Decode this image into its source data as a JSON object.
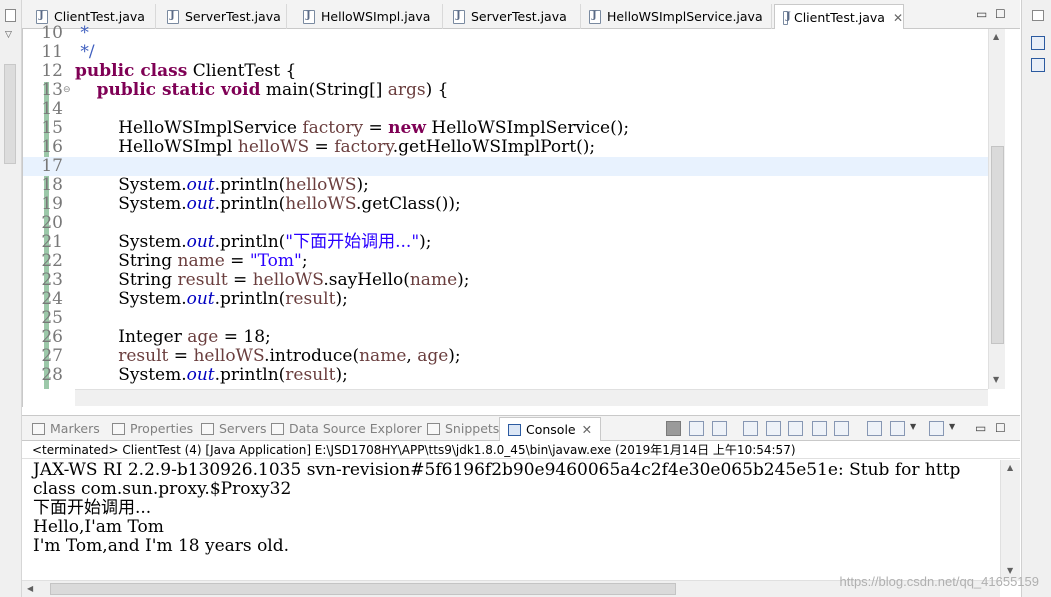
{
  "editor_tabs": [
    {
      "label": "ClientTest.java",
      "active": false
    },
    {
      "label": "ServerTest.java",
      "active": false
    },
    {
      "label": "HelloWSImpl.java",
      "active": false
    },
    {
      "label": "ServerTest.java",
      "active": false
    },
    {
      "label": "HelloWSImplService.java",
      "active": false
    },
    {
      "label": "ClientTest.java",
      "active": true
    }
  ],
  "code_lines": [
    {
      "num": "10",
      "html": " <span class=\"cmt\">*</span>"
    },
    {
      "num": "11",
      "html": " <span class=\"cmt\">*/</span>"
    },
    {
      "num": "12",
      "html": "<span class=\"kw\">public class</span> ClientTest {"
    },
    {
      "num": "13",
      "html": "    <span class=\"kw\">public static void</span> main(String[] <span class=\"var\">args</span>) {"
    },
    {
      "num": "14",
      "html": ""
    },
    {
      "num": "15",
      "html": "        HelloWSImplService <span class=\"var\">factory</span> = <span class=\"kw\">new</span> HelloWSImplService();"
    },
    {
      "num": "16",
      "html": "        HelloWSImpl <span class=\"var\">helloWS</span> = <span class=\"var\">factory</span>.getHelloWSImplPort();"
    },
    {
      "num": "17",
      "html": ""
    },
    {
      "num": "18",
      "html": "        System.<span class=\"fld\">out</span>.println(<span class=\"var\">helloWS</span>);"
    },
    {
      "num": "19",
      "html": "        System.<span class=\"fld\">out</span>.println(<span class=\"var\">helloWS</span>.getClass());"
    },
    {
      "num": "20",
      "html": ""
    },
    {
      "num": "21",
      "html": "        System.<span class=\"fld\">out</span>.println(<span class=\"str\">\"下面开始调用...\"</span>);"
    },
    {
      "num": "22",
      "html": "        String <span class=\"var\">name</span> = <span class=\"str\">\"Tom\"</span>;"
    },
    {
      "num": "23",
      "html": "        String <span class=\"var\">result</span> = <span class=\"var\">helloWS</span>.sayHello(<span class=\"var\">name</span>);"
    },
    {
      "num": "24",
      "html": "        System.<span class=\"fld\">out</span>.println(<span class=\"var\">result</span>);"
    },
    {
      "num": "25",
      "html": ""
    },
    {
      "num": "26",
      "html": "        Integer <span class=\"var\">age</span> = 18;"
    },
    {
      "num": "27",
      "html": "        <span class=\"var\">result</span> = <span class=\"var\">helloWS</span>.introduce(<span class=\"var\">name</span>, <span class=\"var\">age</span>);"
    },
    {
      "num": "28",
      "html": "        System.<span class=\"fld\">out</span>.println(<span class=\"var\">result</span>);"
    }
  ],
  "console_tabs": {
    "markers": "Markers",
    "properties": "Properties",
    "servers": "Servers",
    "data_source_explorer": "Data Source Explorer",
    "snippets": "Snippets",
    "console": "Console"
  },
  "console": {
    "terminated": "<terminated> ClientTest (4) [Java Application] E:\\JSD1708HY\\APP\\tts9\\jdk1.8.0_45\\bin\\javaw.exe (2019年1月14日 上午10:54:57)",
    "lines": [
      "JAX-WS RI 2.2.9-b130926.1035 svn-revision#5f6196f2b90e9460065a4c2f4e30e065b245e51e: Stub for http",
      "class com.sun.proxy.$Proxy32",
      "下面开始调用...",
      "Hello,I'am Tom",
      "I'm Tom,and I'm 18 years old."
    ]
  },
  "watermark": "https://blog.csdn.net/qq_41655159"
}
